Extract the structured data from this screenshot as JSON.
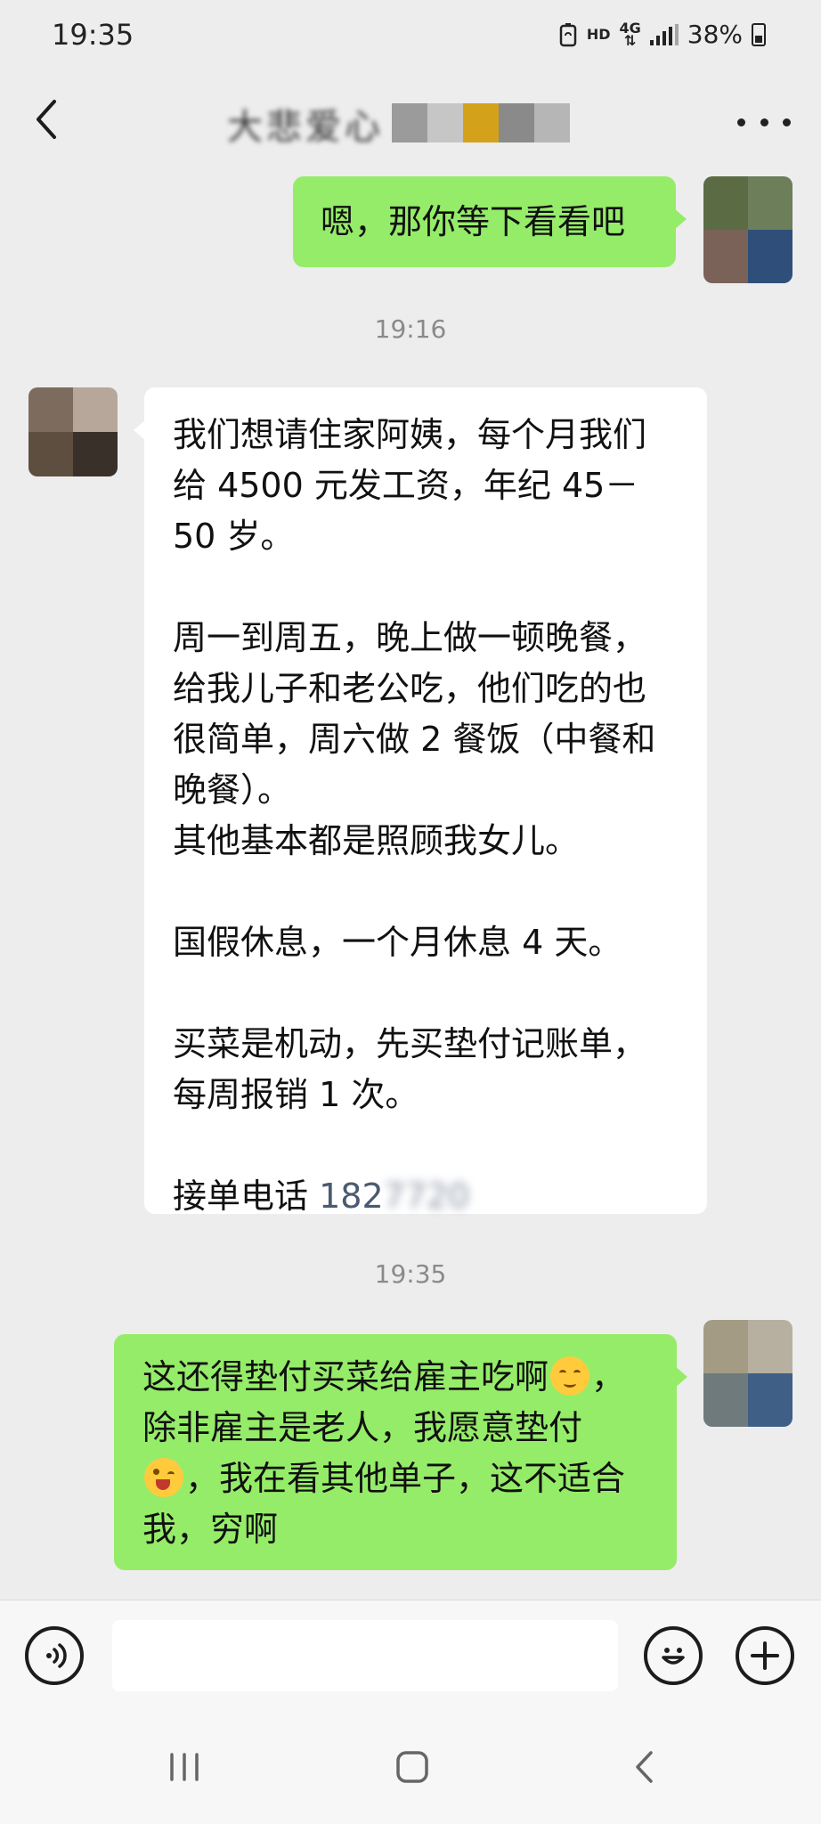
{
  "status_bar": {
    "time": "19:35",
    "network_badge_top": "HD",
    "net_type": "4G",
    "battery_percent": "38%",
    "battery_level": 0.38
  },
  "header": {
    "contact_name_blurred": "大悲爱心",
    "back_icon": "chevron-left-icon",
    "more_icon": "more-dots-icon"
  },
  "messages": [
    {
      "id": "m1",
      "side": "right",
      "lines": [
        "嗯，那你等下看看吧"
      ]
    },
    {
      "id": "ts1",
      "type": "timestamp",
      "text": "19:16"
    },
    {
      "id": "m2",
      "side": "left",
      "lines": [
        "我们想请住家阿姨，每个月我们",
        "给 4500 元发工资，年纪 45－",
        "50 岁。",
        "",
        "周一到周五，晚上做一顿晚餐，",
        "给我儿子和老公吃，他们吃的也",
        "很简单，周六做 2 餐饭（中餐和",
        "晚餐）。",
        "其他基本都是照顾我女儿。",
        "",
        "国假休息，一个月休息 4 天。",
        "",
        "买菜是机动，先买垫付记账单，",
        "每周报销 1 次。",
        ""
      ],
      "phone_label": "接单电话",
      "phone_visible": "182",
      "phone_blurred": "7720"
    },
    {
      "id": "ts2",
      "type": "timestamp",
      "text": "19:35"
    },
    {
      "id": "m3",
      "side": "right",
      "line1_a": "这还得垫付买菜给雇主吃啊",
      "line1_b": "，",
      "line2": "除非雇主是老人，我愿意垫付",
      "line3_b": "，我在看其他单子，这不适合",
      "line4": "我，穷啊",
      "emoji_1": "relieved-face-icon",
      "emoji_2": "winking-face-tongue-icon"
    }
  ],
  "input_bar": {
    "voice_icon": "voice-icon",
    "placeholder": "",
    "emoji_icon": "smiley-icon",
    "plus_icon": "plus-icon"
  },
  "system_nav": {
    "recents_icon": "recents-icon",
    "home_icon": "home-icon",
    "back_icon": "back-icon"
  },
  "colors": {
    "background": "#ededed",
    "bubble_green": "#95ec69",
    "bubble_white": "#ffffff",
    "phone_link": "#4a5a70"
  }
}
